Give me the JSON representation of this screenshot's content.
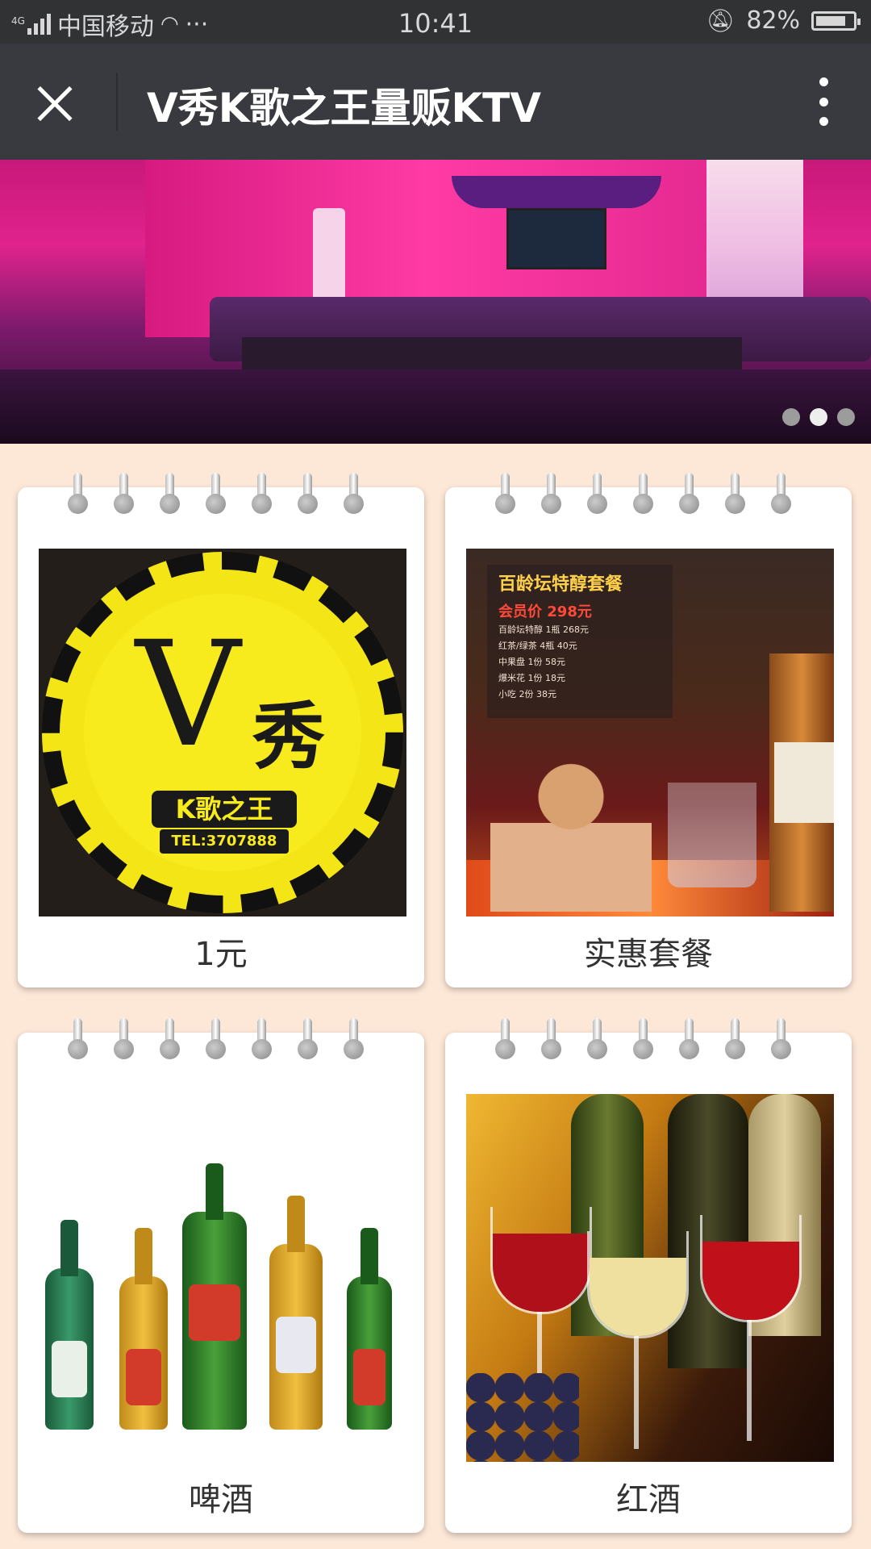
{
  "status_bar": {
    "network": "4G",
    "carrier": "中国移动",
    "more": "···",
    "time": "10:41",
    "battery": "82%",
    "battery_level": 0.82
  },
  "nav": {
    "title": "V秀K歌之王量贩KTV"
  },
  "banner": {
    "slide_count": 3,
    "active_slide": 1
  },
  "products": [
    {
      "label": "1元",
      "logo_mark": "V",
      "logo_char": "秀",
      "logo_brand": "K歌之王",
      "logo_tel": "TEL:3707888"
    },
    {
      "label": "实惠套餐",
      "menu_title": "百龄坛特醇套餐",
      "menu_price": "会员价 298元",
      "menu_rows": [
        "百龄坛特醇 1瓶 268元",
        "红茶/绿茶 4瓶 40元",
        "中果盘 1份 58元",
        "爆米花 1份 18元",
        "小吃 2份 38元"
      ]
    },
    {
      "label": "啤酒"
    },
    {
      "label": "红酒"
    }
  ]
}
